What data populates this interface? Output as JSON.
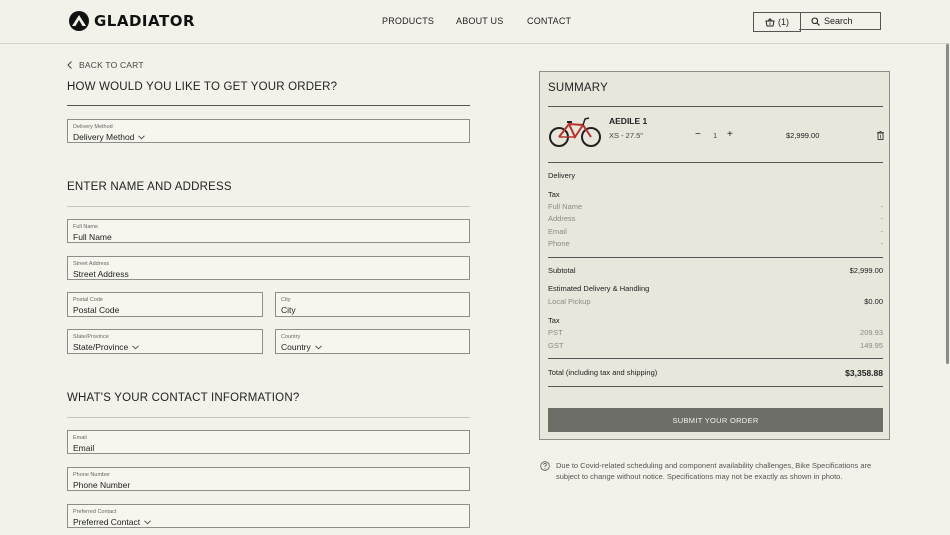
{
  "header": {
    "brand": "GLADIATOR",
    "nav": [
      "PRODUCTS",
      "ABOUT US",
      "CONTACT"
    ],
    "cart_label": "(1)",
    "search_label": "Search"
  },
  "form": {
    "back_label": "BACK TO CART",
    "delivery": {
      "title": "HOW WOULD YOU LIKE TO GET YOUR ORDER?",
      "method_label": "Delivery Method",
      "method_value": "Delivery Method"
    },
    "address": {
      "title": "ENTER NAME AND ADDRESS",
      "full_name_label": "Full Name",
      "full_name_value": "Full Name",
      "street_label": "Street Address",
      "street_value": "Street Address",
      "postal_label": "Postal Code",
      "postal_value": "Postal Code",
      "city_label": "City",
      "city_value": "City",
      "state_label": "State/Province",
      "state_value": "State/Province",
      "country_label": "Country",
      "country_value": "Country"
    },
    "contact": {
      "title": "WHAT'S YOUR CONTACT INFORMATION?",
      "email_label": "Email",
      "email_value": "Email",
      "phone_label": "Phone Number",
      "phone_value": "Phone Number",
      "pref_label": "Preferred Contact",
      "pref_value": "Preferred Contact"
    }
  },
  "summary": {
    "title": "SUMMARY",
    "item": {
      "name": "AEDILE 1",
      "variant": "XS - 27.5\"",
      "qty": "1",
      "price": "$2,999.00"
    },
    "delivery_heading": "Delivery",
    "tax_heading": "Tax",
    "details": [
      {
        "label": "Full Name",
        "value": "-"
      },
      {
        "label": "Address",
        "value": "-"
      },
      {
        "label": "Email",
        "value": "-"
      },
      {
        "label": "Phone",
        "value": "-"
      }
    ],
    "subtotal_label": "Subtotal",
    "subtotal_value": "$2,999.00",
    "handling_label": "Estimated Delivery & Handling",
    "pickup_label": "Local Pickup",
    "pickup_value": "$0.00",
    "tax_label": "Tax",
    "pst_label": "PST",
    "pst_value": "209.93",
    "gst_label": "GST",
    "gst_value": "149.95",
    "total_label": "Total (including tax and shipping)",
    "total_value": "$3,358.88",
    "submit_label": "SUBMIT YOUR ORDER"
  },
  "notice": "Due to Covid-related scheduling and component availability challenges, Bike Specifications are subject to change without notice. Specifications may not be exactly as shown in photo."
}
